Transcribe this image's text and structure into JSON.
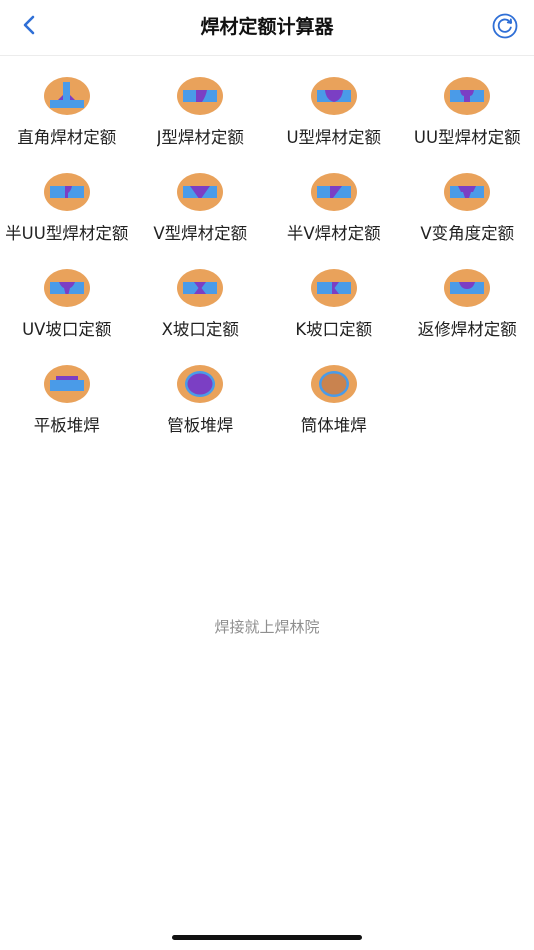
{
  "header": {
    "title": "焊材定额计算器"
  },
  "items": [
    {
      "label": "直角焊材定额",
      "icon": "fillet-weld-icon"
    },
    {
      "label": "J型焊材定额",
      "icon": "j-groove-icon"
    },
    {
      "label": "U型焊材定额",
      "icon": "u-groove-icon"
    },
    {
      "label": "UU型焊材定额",
      "icon": "uu-groove-icon"
    },
    {
      "label": "半UU型焊材定额",
      "icon": "half-uu-groove-icon"
    },
    {
      "label": "V型焊材定额",
      "icon": "v-groove-icon"
    },
    {
      "label": "半V焊材定额",
      "icon": "half-v-groove-icon"
    },
    {
      "label": "V变角度定额",
      "icon": "v-variable-angle-icon"
    },
    {
      "label": "UV坡口定额",
      "icon": "uv-groove-icon"
    },
    {
      "label": "X坡口定额",
      "icon": "x-groove-icon"
    },
    {
      "label": "K坡口定额",
      "icon": "k-groove-icon"
    },
    {
      "label": "返修焊材定额",
      "icon": "repair-weld-icon"
    },
    {
      "label": "平板堆焊",
      "icon": "plate-overlay-icon"
    },
    {
      "label": "管板堆焊",
      "icon": "tube-sheet-overlay-icon"
    },
    {
      "label": "筒体堆焊",
      "icon": "cylinder-overlay-icon"
    }
  ],
  "footer": {
    "slogan": "焊接就上焊林院"
  },
  "colors": {
    "icon_bg": "#E9A25B",
    "plate": "#4A9BE8",
    "weld": "#7B3FC4",
    "accent": "#2F6FD6"
  }
}
